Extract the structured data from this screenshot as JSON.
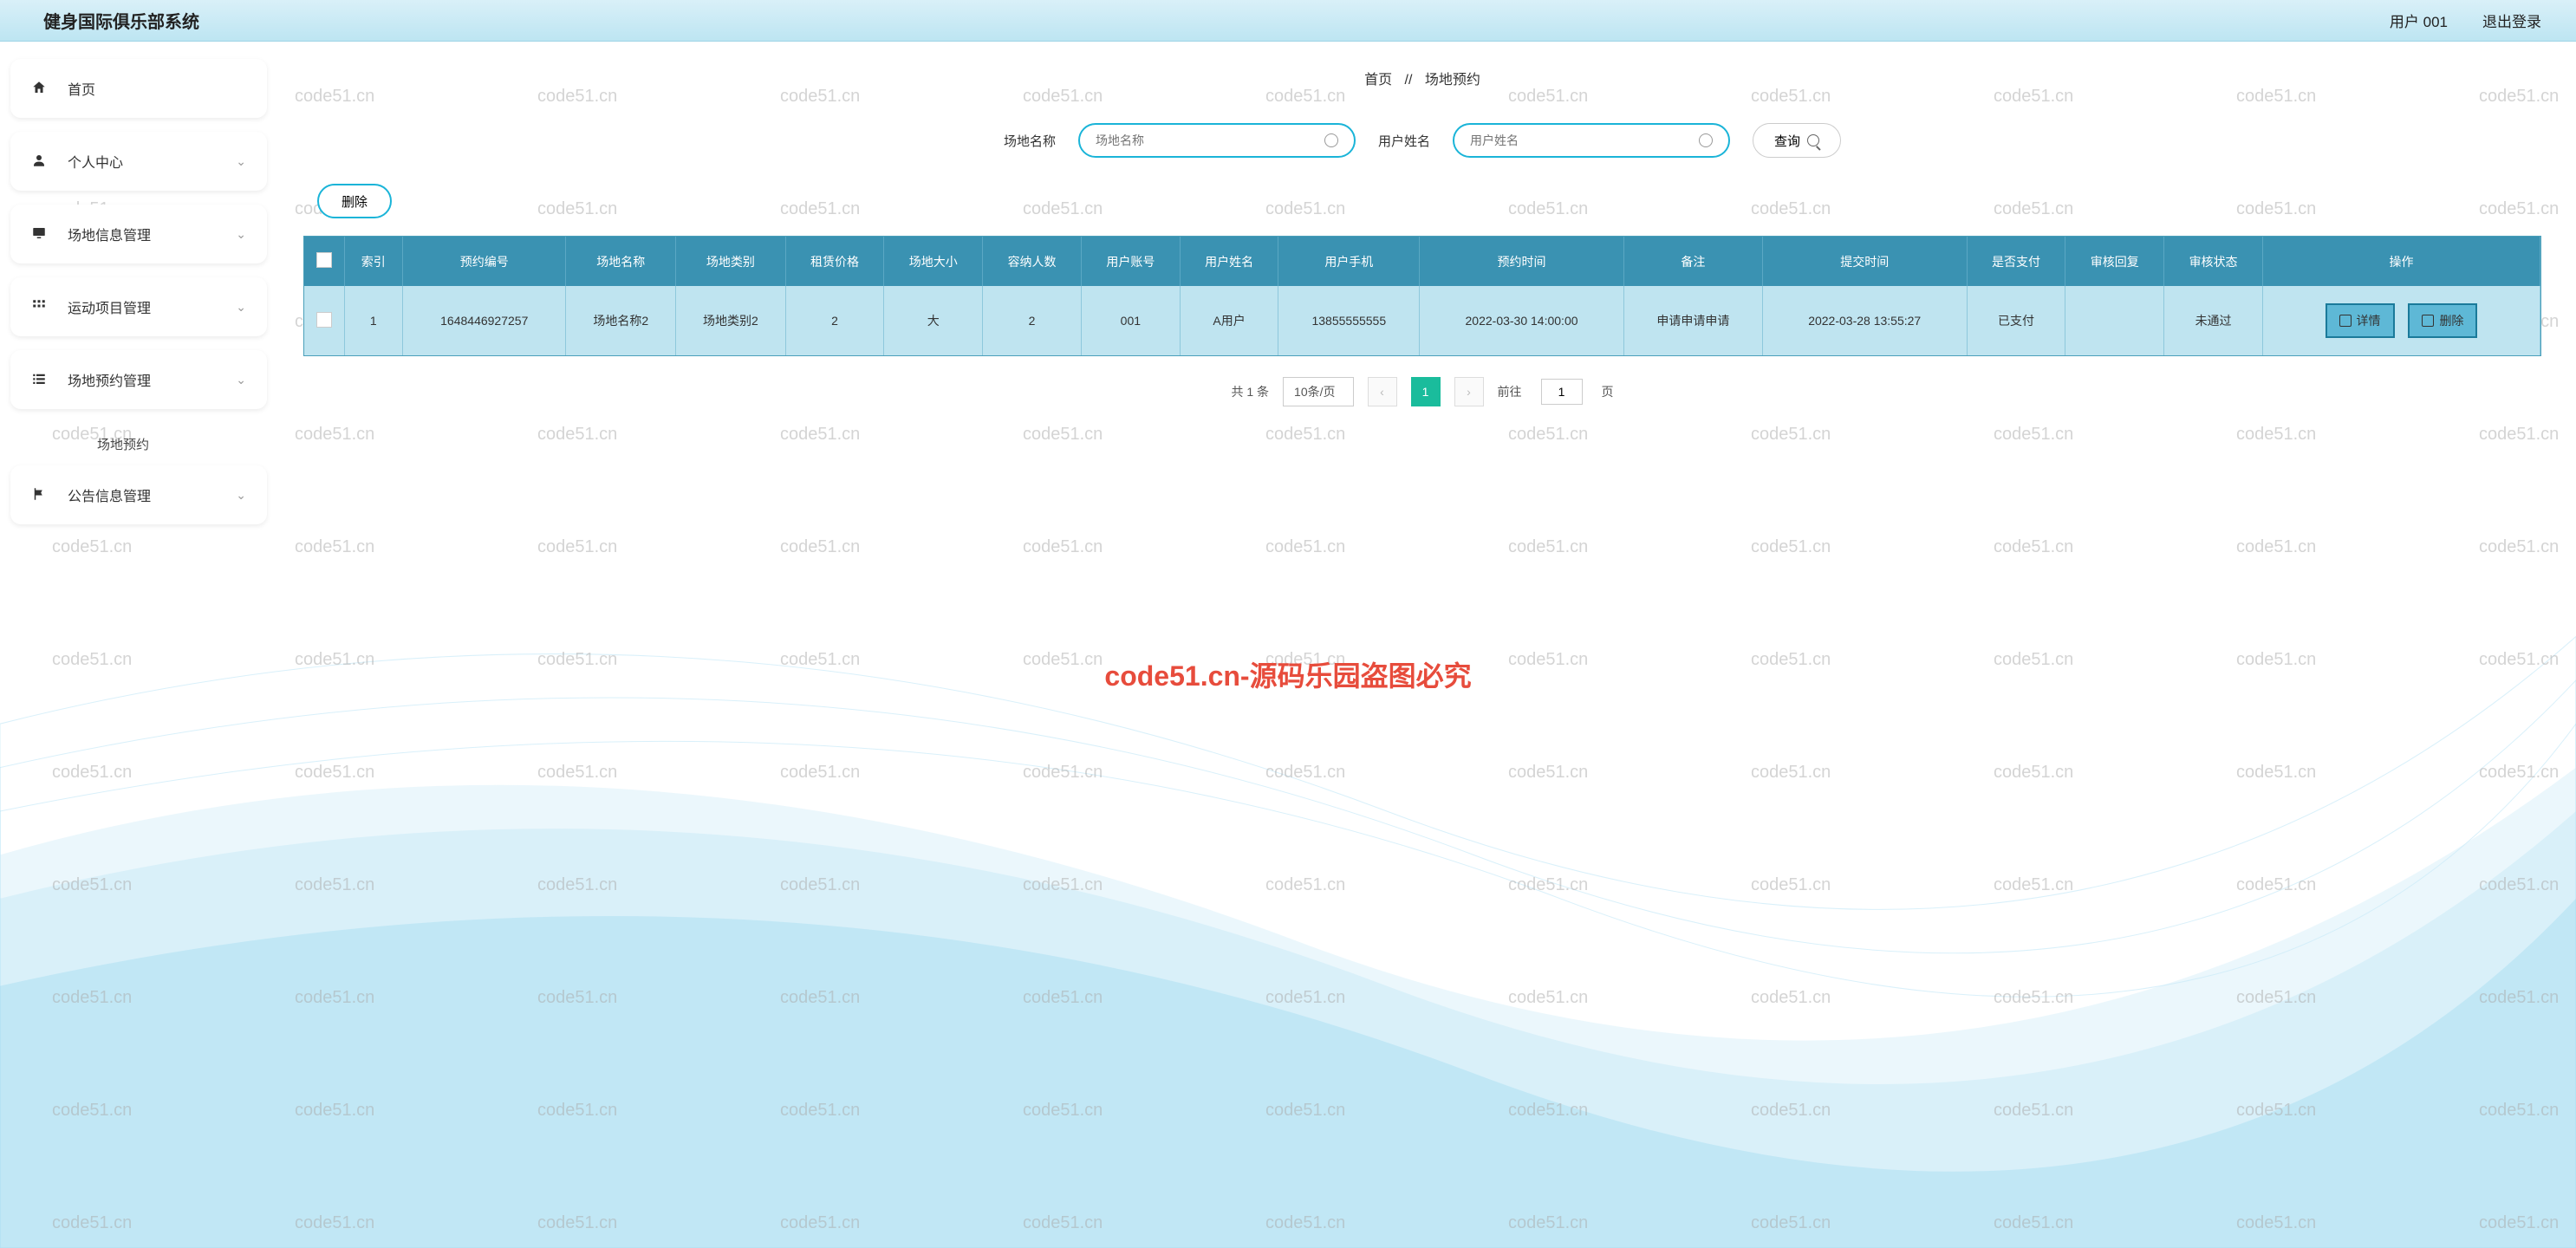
{
  "header": {
    "title": "健身国际俱乐部系统",
    "user": "用户 001",
    "logout": "退出登录"
  },
  "sidebar": {
    "items": [
      {
        "icon": "home",
        "label": "首页",
        "expandable": false
      },
      {
        "icon": "user",
        "label": "个人中心",
        "expandable": true
      },
      {
        "icon": "monitor",
        "label": "场地信息管理",
        "expandable": true
      },
      {
        "icon": "grid",
        "label": "运动项目管理",
        "expandable": true
      },
      {
        "icon": "list",
        "label": "场地预约管理",
        "expandable": true,
        "expanded": true,
        "children": [
          "场地预约"
        ]
      },
      {
        "icon": "flag",
        "label": "公告信息管理",
        "expandable": true
      }
    ]
  },
  "breadcrumb": {
    "home": "首页",
    "sep": "//",
    "current": "场地预约"
  },
  "search": {
    "field1_label": "场地名称",
    "field1_placeholder": "场地名称",
    "field2_label": "用户姓名",
    "field2_placeholder": "用户姓名",
    "query_btn": "查询"
  },
  "toolbar": {
    "delete_btn": "删除"
  },
  "table": {
    "headers": [
      "索引",
      "预约编号",
      "场地名称",
      "场地类别",
      "租赁价格",
      "场地大小",
      "容纳人数",
      "用户账号",
      "用户姓名",
      "用户手机",
      "预约时间",
      "备注",
      "提交时间",
      "是否支付",
      "审核回复",
      "审核状态",
      "操作"
    ],
    "rows": [
      {
        "cells": [
          "1",
          "1648446927257",
          "场地名称2",
          "场地类别2",
          "2",
          "大",
          "2",
          "001",
          "A用户",
          "13855555555",
          "2022-03-30 14:00:00",
          "申请申请申请",
          "2022-03-28 13:55:27",
          "已支付",
          "",
          "未通过"
        ],
        "actions": [
          {
            "icon": "doc",
            "label": "详情"
          },
          {
            "icon": "doc",
            "label": "删除"
          }
        ]
      }
    ]
  },
  "pagination": {
    "total": "共 1 条",
    "page_size": "10条/页",
    "current": "1",
    "goto_label_prefix": "前往",
    "goto_value": "1",
    "goto_label_suffix": "页"
  },
  "watermark_text": "code51.cn",
  "center_watermark": "code51.cn-源码乐园盗图必究"
}
